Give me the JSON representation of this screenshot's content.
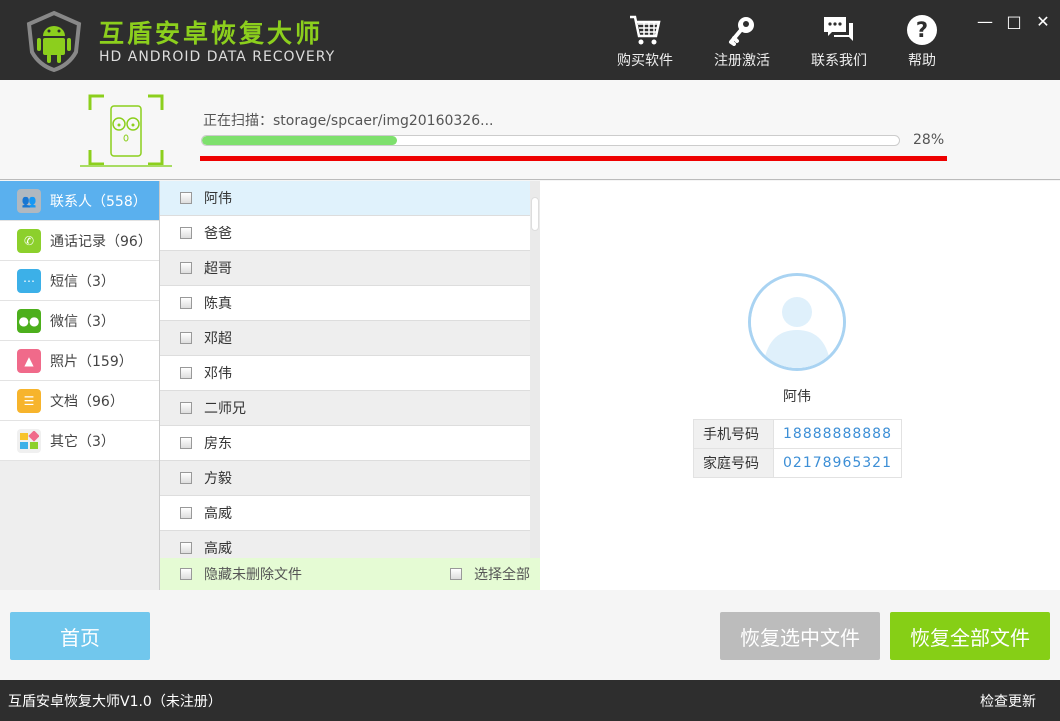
{
  "header": {
    "title": "互盾安卓恢复大师",
    "subtitle": "HD ANDROID DATA RECOVERY",
    "tools": [
      {
        "label": "购买软件",
        "icon": "cart-icon"
      },
      {
        "label": "注册激活",
        "icon": "key-icon"
      },
      {
        "label": "联系我们",
        "icon": "chat-icon"
      },
      {
        "label": "帮助",
        "icon": "help-icon"
      }
    ]
  },
  "scan": {
    "status": "正在扫描：storage/spcaer/img20160326...",
    "progress_percent": 28,
    "progress_label": "28%"
  },
  "sidebar": {
    "items": [
      {
        "label": "联系人（558）",
        "color": "#b0b8c0"
      },
      {
        "label": "通话记录（96）",
        "color": "#8cd02c"
      },
      {
        "label": "短信（3）",
        "color": "#3cb0e8"
      },
      {
        "label": "微信（3）",
        "color": "#4caf1c"
      },
      {
        "label": "照片（159）",
        "color": "#f06a8a"
      },
      {
        "label": "文档（96）",
        "color": "#f7b42c"
      },
      {
        "label": "其它（3）",
        "color": "#f0f0f0"
      }
    ]
  },
  "list": {
    "items": [
      "阿伟",
      "爸爸",
      "超哥",
      "陈真",
      "邓超",
      "邓伟",
      "二师兄",
      "房东",
      "方毅",
      "高威",
      "高威"
    ],
    "hide_undeleted": "隐藏未删除文件",
    "select_all": "选择全部"
  },
  "detail": {
    "name": "阿伟",
    "fields": [
      {
        "key": "手机号码",
        "value": "18888888888"
      },
      {
        "key": "家庭号码",
        "value": "02178965321"
      }
    ]
  },
  "buttons": {
    "home": "首页",
    "recover_selected": "恢复选中文件",
    "recover_all": "恢复全部文件"
  },
  "statusbar": {
    "version": "互盾安卓恢复大师V1.0（未注册）",
    "check_update": "检查更新"
  }
}
